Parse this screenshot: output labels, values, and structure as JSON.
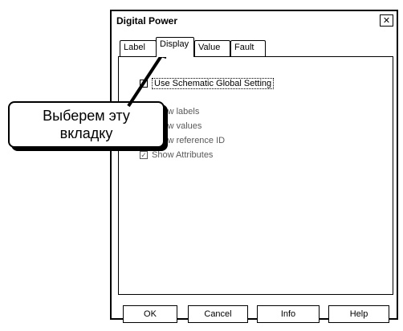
{
  "dialog": {
    "title": "Digital Power",
    "close_glyph": "✕"
  },
  "tabs": [
    {
      "label": "Label",
      "active": false
    },
    {
      "label": "Display",
      "active": true
    },
    {
      "label": "Value",
      "active": false
    },
    {
      "label": "Fault",
      "active": false
    }
  ],
  "display_panel": {
    "use_global": {
      "label": "Use Schematic Global Setting",
      "checked": false
    },
    "show_labels": {
      "label": "Show labels",
      "checked": false
    },
    "show_values": {
      "label": "Show values",
      "checked": false
    },
    "show_refid": {
      "label": "Show reference ID",
      "checked": false
    },
    "show_attributes": {
      "label": "Show Attributes",
      "checked": true
    }
  },
  "buttons": {
    "ok": "OK",
    "cancel": "Cancel",
    "info": "Info",
    "help": "Help"
  },
  "callout": {
    "line1": "Выберем эту",
    "line2": "вкладку"
  },
  "check_glyph": "✓"
}
